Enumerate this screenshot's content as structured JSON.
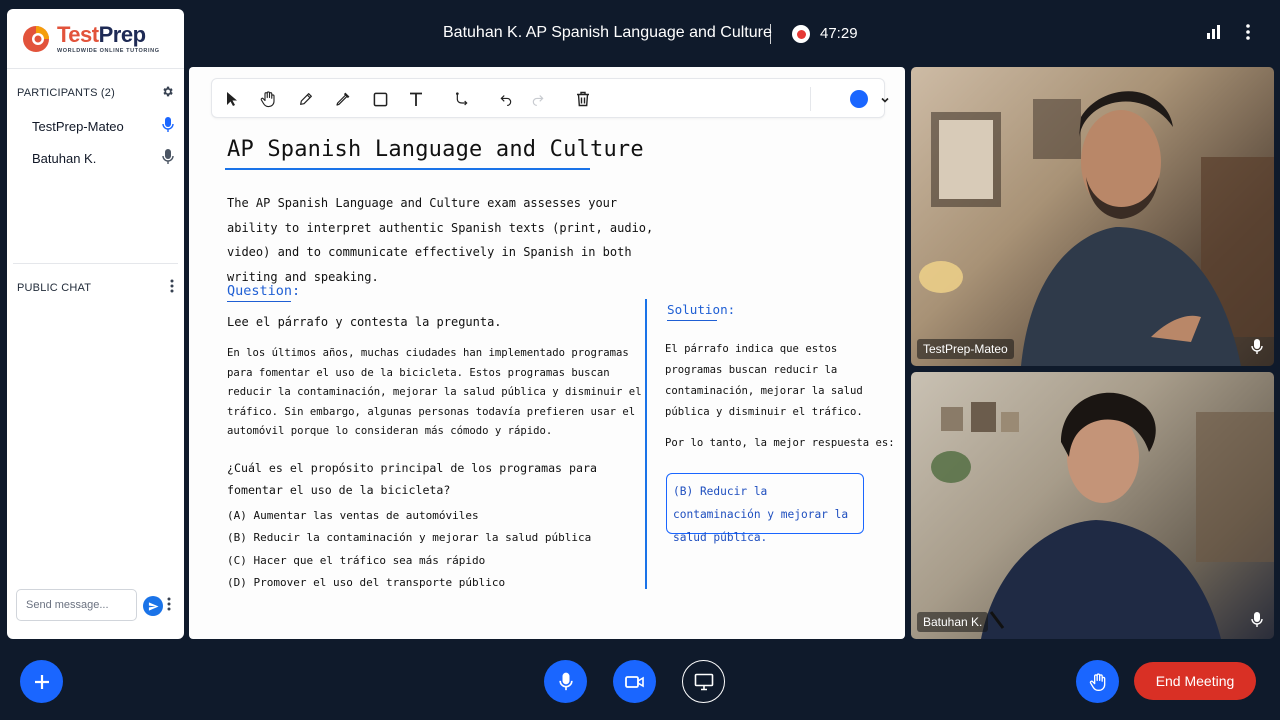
{
  "brand": {
    "title_part1": "Test",
    "title_part2": "Prep",
    "tagline": "WORLDWIDE ONLINE TUTORING"
  },
  "topbar": {
    "title": "Batuhan K. AP Spanish Language and Culture",
    "timer": "47:29"
  },
  "sidebar": {
    "participants_header": "PARTICIPANTS (2)",
    "participants": [
      {
        "name": "TestPrep-Mateo",
        "mic_state": "active"
      },
      {
        "name": "Batuhan K.",
        "mic_state": "on"
      }
    ],
    "chat_header": "PUBLIC CHAT",
    "chat_placeholder": "Send message..."
  },
  "whiteboard": {
    "toolbar": {
      "tools": [
        "select-tool",
        "hand-tool",
        "pencil-tool",
        "marker-tool",
        "shape-tool",
        "text-tool",
        "connector-tool",
        "undo",
        "redo",
        "delete"
      ],
      "selected_color": "#1a66ff"
    },
    "title": "AP Spanish Language and Culture",
    "intro": "The AP Spanish Language and Culture exam assesses your ability to interpret authentic Spanish texts (print, audio, video) and to communicate effectively in Spanish in both writing and speaking.",
    "question_label": "Question:",
    "question_instruction": "Lee el párrafo y contesta la pregunta.",
    "passage": "En los últimos años, muchas ciudades han implementado programas para fomentar el uso de la bicicleta. Estos programas buscan reducir la contaminación, mejorar la salud pública y disminuir el tráfico. Sin embargo, algunas personas todavía prefieren usar el automóvil porque lo consideran más cómodo y rápido.",
    "prompt": "¿Cuál es el propósito principal de los programas para fomentar el uso de la bicicleta?",
    "options": [
      "(A) Aumentar las ventas de automóviles",
      "(B) Reducir la contaminación y mejorar la salud pública",
      "(C) Hacer que el tráfico sea más rápido",
      "(D) Promover el uso del transporte público"
    ],
    "solution_label": "Solution:",
    "solution_text": "El párrafo indica que estos programas buscan reducir la contaminación, mejorar la salud pública y disminuir el tráfico.",
    "solution_conclusion": "Por lo tanto, la mejor respuesta es:",
    "answer": "(B) Reducir la contaminación y mejorar la salud pública."
  },
  "videos": [
    {
      "name": "TestPrep-Mateo"
    },
    {
      "name": "Batuhan K."
    }
  ],
  "controls": {
    "end_label": "End Meeting"
  },
  "colors": {
    "accent": "#1a66ff",
    "danger": "#d93025",
    "background": "#0f1a2b",
    "brand_orange": "#e2533b",
    "brand_navy": "#1e2a55"
  }
}
